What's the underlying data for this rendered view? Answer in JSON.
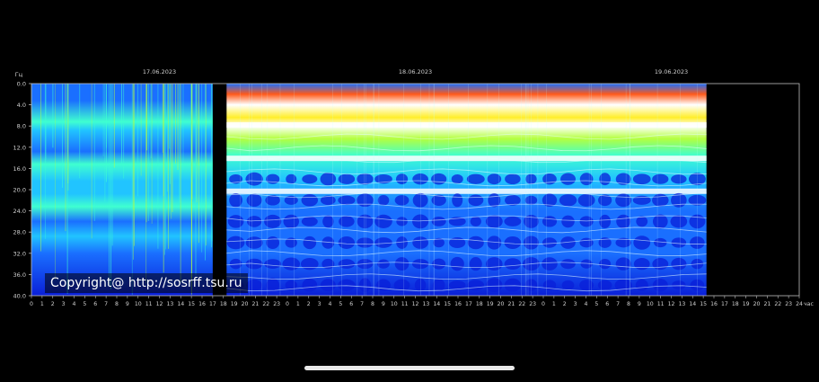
{
  "chart_data": {
    "type": "heatmap",
    "title": "",
    "ylabel": "Гц",
    "xlabel": "час",
    "ylim": [
      0,
      40
    ],
    "y_ticks": [
      "0.0",
      "4.0",
      "8.0",
      "12.0",
      "16.0",
      "20.0",
      "24.0",
      "28.0",
      "32.0",
      "36.0",
      "40.0"
    ],
    "dates": [
      {
        "label": "17.06.2023",
        "hour_offset": 12
      },
      {
        "label": "18.06.2023",
        "hour_offset": 36
      },
      {
        "label": "19.06.2023",
        "hour_offset": 60
      }
    ],
    "x_hour_labels": [
      "0",
      "1",
      "2",
      "3",
      "4",
      "5",
      "6",
      "7",
      "8",
      "9",
      "10",
      "11",
      "12",
      "13",
      "14",
      "15",
      "16",
      "17",
      "18",
      "19",
      "20",
      "21",
      "22",
      "23",
      "0",
      "1",
      "2",
      "3",
      "4",
      "5",
      "6",
      "7",
      "8",
      "9",
      "10",
      "11",
      "12",
      "13",
      "14",
      "15",
      "16",
      "17",
      "18",
      "19",
      "20",
      "21",
      "22",
      "23",
      "0",
      "1",
      "2",
      "3",
      "4",
      "5",
      "6",
      "7",
      "8",
      "9",
      "10",
      "11",
      "12",
      "13",
      "14",
      "15",
      "16",
      "17",
      "18",
      "19",
      "20",
      "21",
      "22",
      "23",
      "24"
    ],
    "data_segments": [
      {
        "start_hour": 0,
        "end_hour": 17,
        "style": "noisy"
      },
      {
        "start_hour": 18.3,
        "end_hour": 63.3,
        "style": "banded"
      }
    ],
    "resonance_bands_hz": [
      7.8,
      14.1,
      20.3
    ],
    "colormap": [
      "#0a1fd8",
      "#1a6fff",
      "#21c4ff",
      "#3fffd0",
      "#b4ff3f",
      "#ffee2a",
      "#ff5a1a",
      "#ffffff"
    ],
    "annotation": "Copyright@ http://sosrff.tsu.ru"
  }
}
